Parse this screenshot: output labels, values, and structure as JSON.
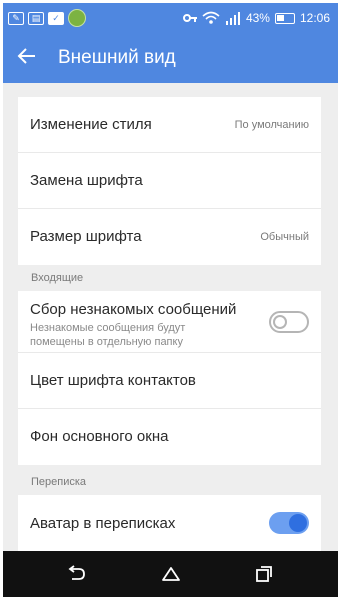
{
  "status_bar": {
    "battery_percent": "43%",
    "time": "12:06"
  },
  "app_bar": {
    "title": "Внешний вид"
  },
  "settings": {
    "change_style": {
      "label": "Изменение стиля",
      "value": "По умолчанию"
    },
    "font_replace": {
      "label": "Замена шрифта"
    },
    "font_size": {
      "label": "Размер шрифта",
      "value": "Обычный"
    }
  },
  "incoming": {
    "section_title": "Входящие",
    "collect_unknown": {
      "label": "Сбор незнакомых сообщений",
      "sub_line1": "Незнакомые сообщения будут",
      "sub_line2": "помещены в отдельную папку",
      "enabled": false
    },
    "contacts_font_color": {
      "label": "Цвет шрифта контактов"
    },
    "main_background": {
      "label": "Фон основного окна"
    }
  },
  "conversation": {
    "section_title": "Переписка",
    "avatar": {
      "label": "Аватар в переписках",
      "enabled": true
    }
  },
  "colors": {
    "accent": "#4f87e0",
    "toggle_on": "#2f6fe0",
    "background": "#eeeeee"
  },
  "icons": [
    "back-arrow-icon",
    "key-icon",
    "wifi-icon",
    "signal-icon",
    "battery-icon",
    "nav-back-icon",
    "nav-home-icon",
    "nav-recents-icon"
  ]
}
